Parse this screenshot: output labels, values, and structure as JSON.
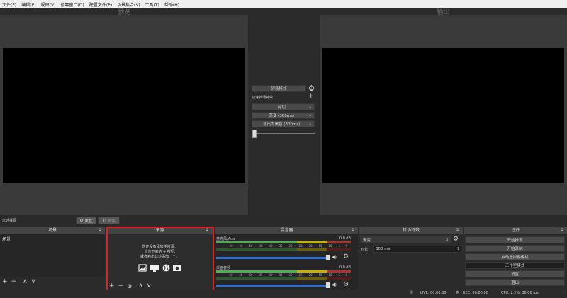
{
  "menu": [
    "文件(F)",
    "编辑(E)",
    "视图(V)",
    "停靠窗口(D)",
    "配置文件(P)",
    "场景集合(S)",
    "工具(T)",
    "帮助(H)"
  ],
  "preview": {
    "title": "预览"
  },
  "program": {
    "title": "输出"
  },
  "transition_center": {
    "transition_label": "转场特效",
    "quick_label": "快速转场特效",
    "items": [
      "剪切",
      "渐变 (300ms)",
      "淡出为黑色 (300ms)"
    ]
  },
  "status_left": "未选择源",
  "props_button": "属性",
  "filters_button": "滤镜",
  "scenes": {
    "title": "场景",
    "items": [
      "场景"
    ]
  },
  "sources": {
    "title": "来源",
    "empty_line1": "您还没有添加任何源。",
    "empty_line2": "点击下面的 + 按钮,",
    "empty_line3": "或者右击此处添加一个。"
  },
  "mixer": {
    "title": "混音器",
    "channels": [
      {
        "name": "麦克风/Aux",
        "db": "0.0 dB"
      },
      {
        "name": "桌面音频",
        "db": "0.0 dB"
      }
    ],
    "ticks": [
      "-60",
      "-55",
      "-50",
      "-45",
      "-40",
      "-35",
      "-30",
      "-25",
      "-20",
      "-15",
      "-10",
      "-5",
      "0"
    ]
  },
  "transitions_dock": {
    "title": "转场特效",
    "selected": "渐变",
    "duration_label": "时长",
    "duration_value": "300 ms"
  },
  "controls": {
    "title": "控件",
    "buttons": [
      "开始推流",
      "开始录制",
      "启动虚拟摄像机",
      "工作室模式",
      "设置",
      "退出"
    ]
  },
  "statusbar": {
    "live": "LIVE: 00:00:00",
    "rec": "REC: 00:00:00",
    "cpu": "CPU: 2.2%, 30.00 fps"
  },
  "colors": {
    "highlight_border": "#e02020",
    "meter_green": "#4caf50",
    "meter_yellow": "#c8b400",
    "meter_red": "#b03030",
    "slider_blue": "#2d6fd6"
  }
}
